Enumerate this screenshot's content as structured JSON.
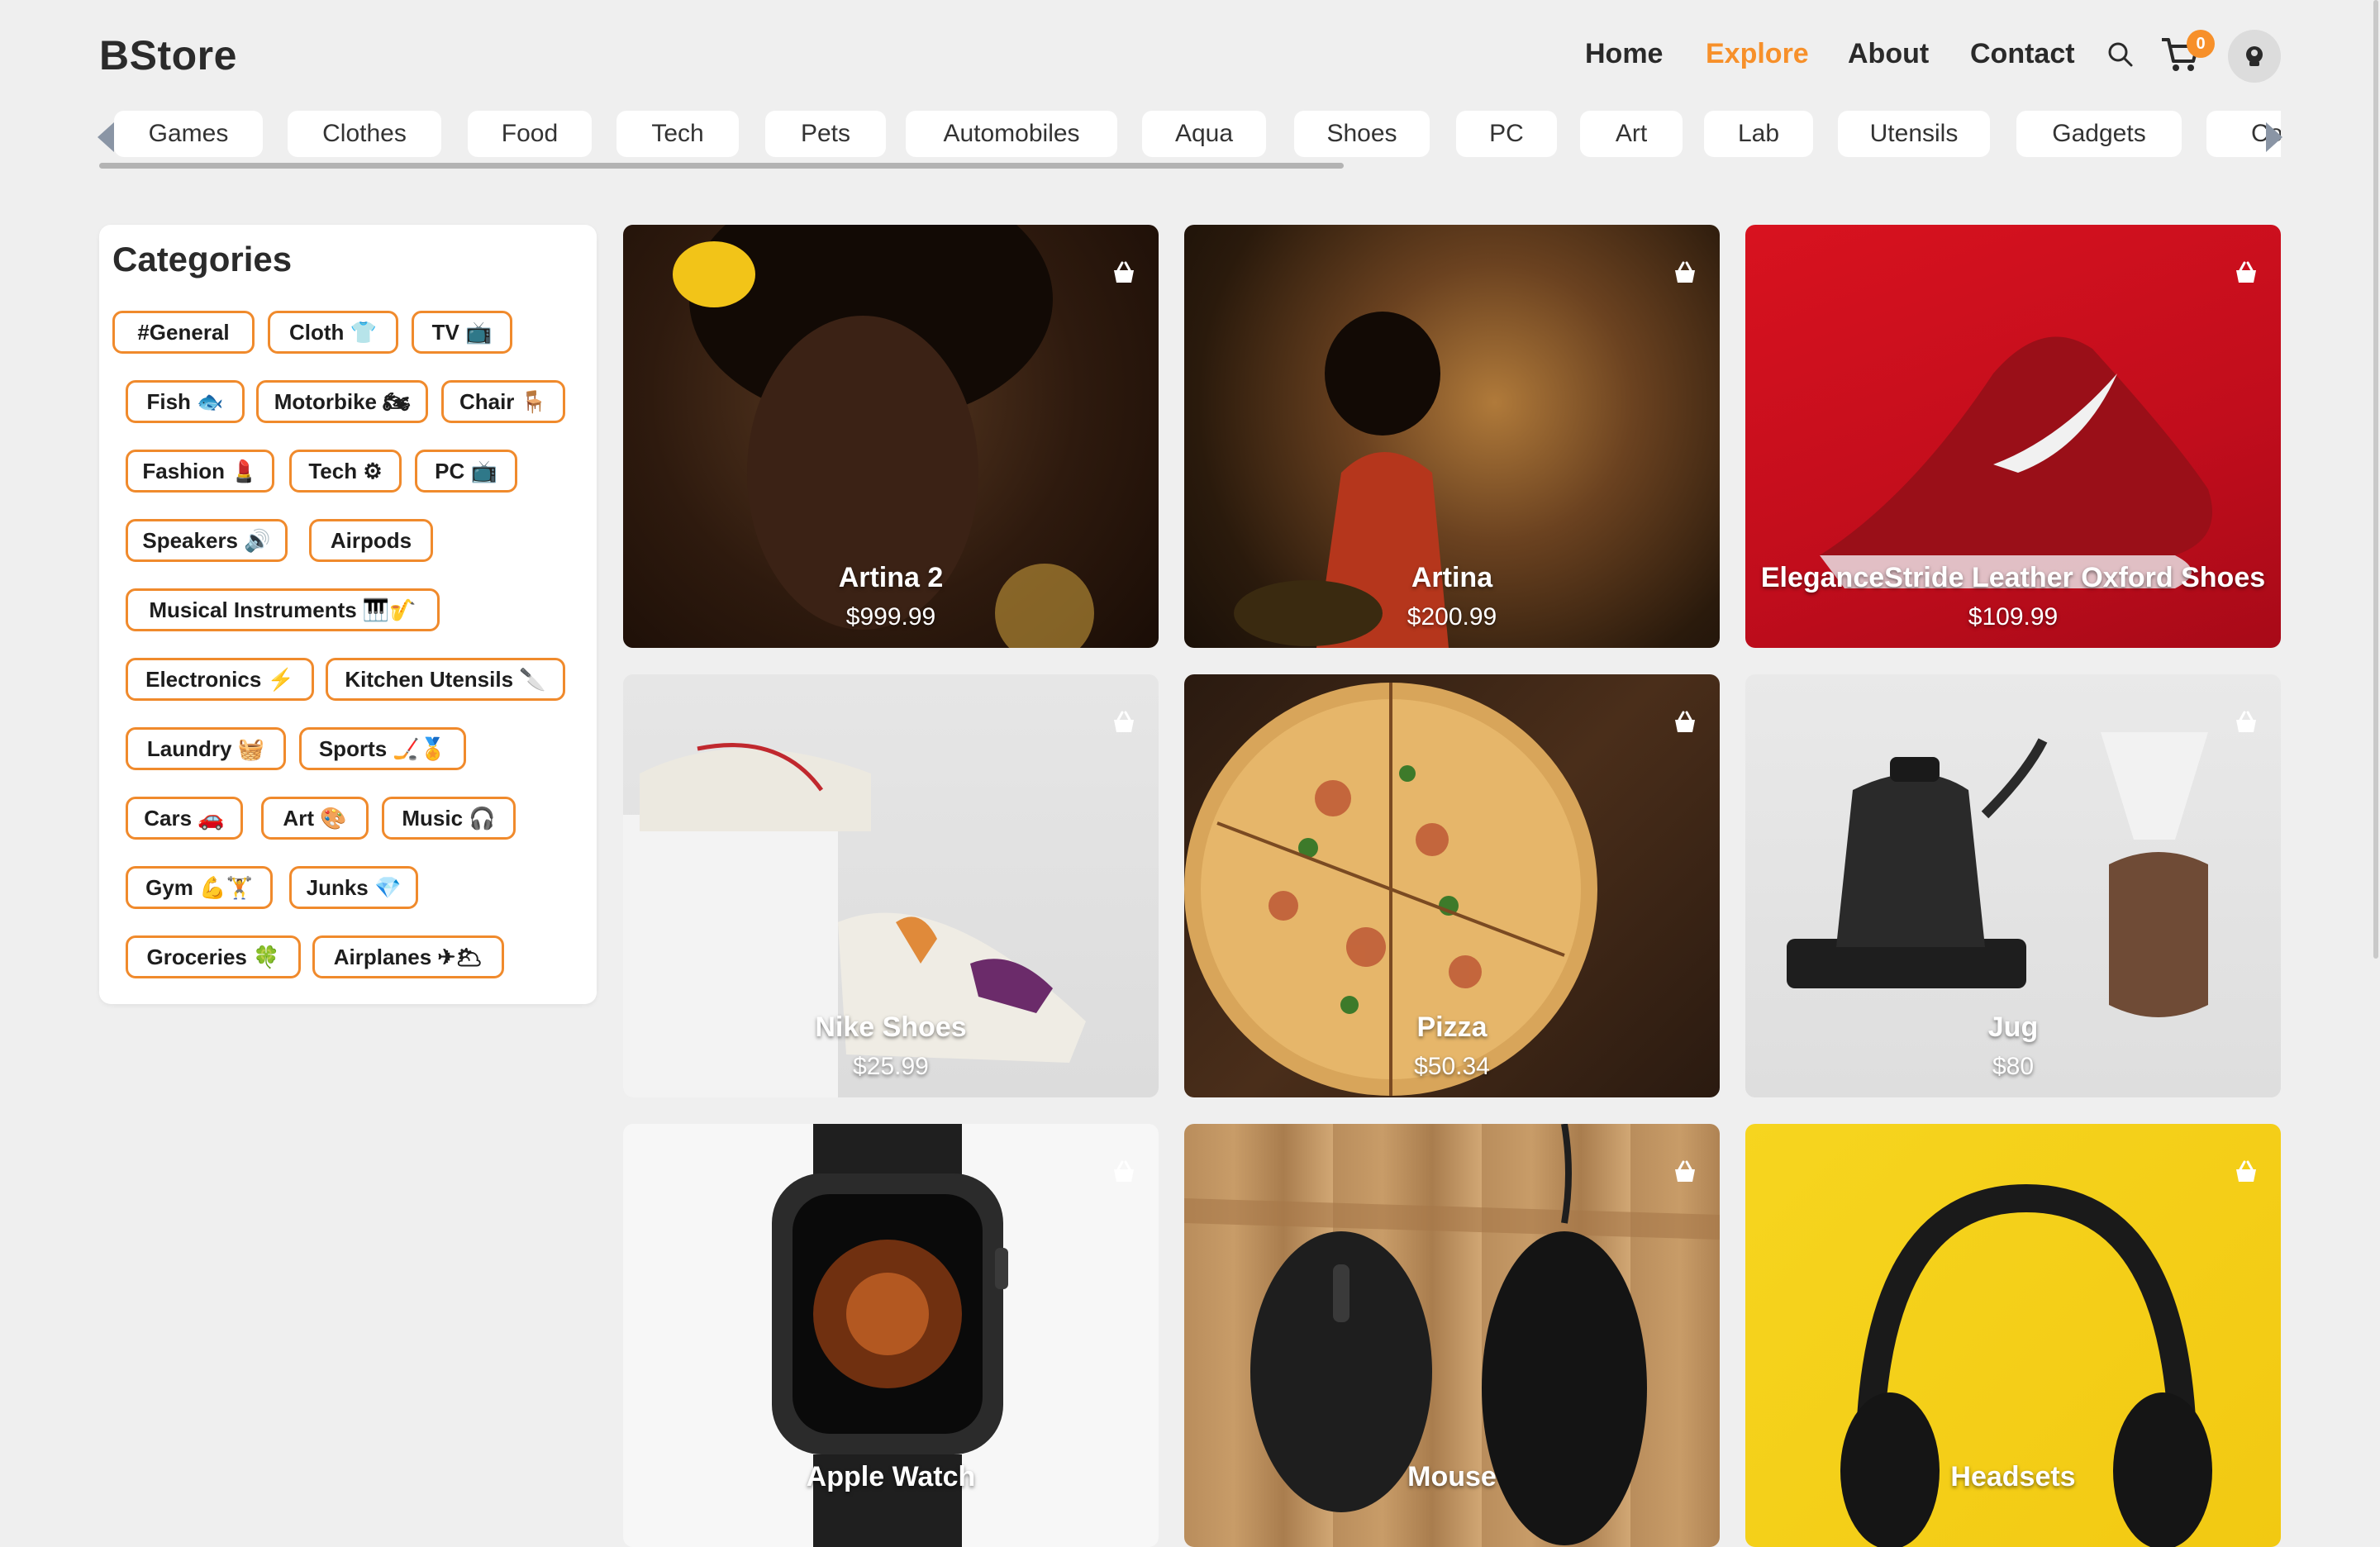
{
  "brand": {
    "name": "BStore",
    "accent": "#f7902a"
  },
  "nav": {
    "items": [
      {
        "label": "Home",
        "active": false
      },
      {
        "label": "Explore",
        "active": true
      },
      {
        "label": "About",
        "active": false
      },
      {
        "label": "Contact",
        "active": false
      }
    ],
    "cart_count": "0",
    "icons": [
      "search-icon",
      "cart-icon",
      "user-avatar-icon"
    ]
  },
  "category_strip": [
    "Games",
    "Clothes",
    "Food",
    "Tech",
    "Pets",
    "Automobiles",
    "Aqua",
    "Shoes",
    "PC",
    "Art",
    "Lab",
    "Utensils",
    "Gadgets",
    "Co"
  ],
  "sidebar": {
    "title": "Categories",
    "tags": [
      "#General",
      "Cloth 👕",
      "TV 📺",
      "Fish 🐟",
      "Motorbike 🏍",
      "Chair 🪑",
      "Fashion 💄",
      "Tech ⚙",
      "PC 📺",
      "Speakers 🔊",
      "Airpods",
      "Musical Instruments 🎹🎷",
      "Electronics ⚡",
      "Kitchen Utensils 🔪",
      "Laundry 🧺",
      "Sports 🏒🏅",
      "Cars 🚗",
      "Art 🎨",
      "Music 🎧",
      "Gym 💪🏋",
      "Junks 💎",
      "Groceries 🍀",
      "Airplanes ✈🌥"
    ]
  },
  "products": [
    {
      "name": "Artina 2",
      "price": "$999.99"
    },
    {
      "name": "Artina",
      "price": "$200.99"
    },
    {
      "name": "EleganceStride Leather Oxford Shoes",
      "price": "$109.99"
    },
    {
      "name": "Nike Shoes",
      "price": "$25.99"
    },
    {
      "name": "Pizza",
      "price": "$50.34"
    },
    {
      "name": "Jug",
      "price": "$80"
    },
    {
      "name": "Apple Watch",
      "price": ""
    },
    {
      "name": "Mouse",
      "price": ""
    },
    {
      "name": "Headsets",
      "price": ""
    }
  ]
}
